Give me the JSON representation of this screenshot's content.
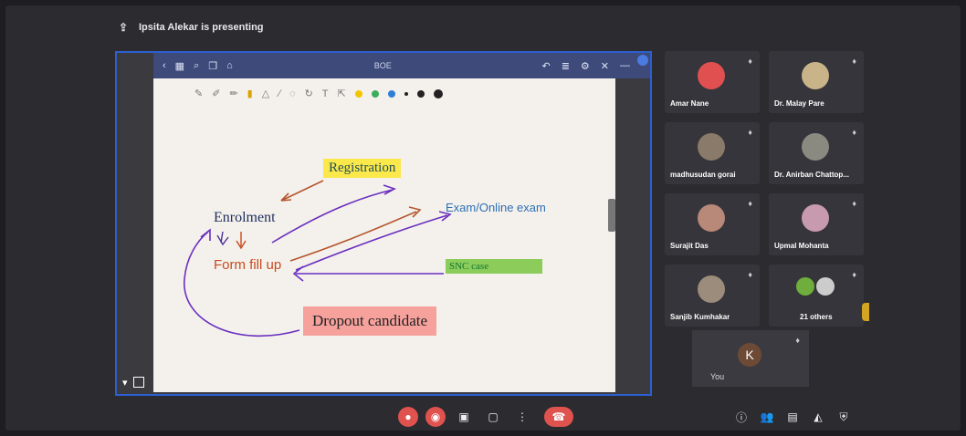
{
  "top_bar": {
    "presenting_text": "Ipsita Alekar is presenting"
  },
  "share": {
    "app_title": "BOE",
    "whiteboard": {
      "registration": "Registration",
      "enrolment": "Enrolment",
      "exam": "Exam/Online exam",
      "form": "Form fill up",
      "snc": "SNC case",
      "dropout": "Dropout candidate"
    }
  },
  "participants": [
    {
      "name": "Amar Nane",
      "avatar_color": "#e05050"
    },
    {
      "name": "Dr. Malay Pare",
      "avatar_color": "#c9b48a"
    },
    {
      "name": "madhusudan gorai",
      "avatar_color": "#8a7a6a"
    },
    {
      "name": "Dr. Anirban Chattop...",
      "avatar_color": "#8a8a80"
    },
    {
      "name": "Surajit Das",
      "avatar_color": "#b88878"
    },
    {
      "name": "Upmal Mohanta",
      "avatar_color": "#c89ab0"
    },
    {
      "name": "Sanjib Kumhakar",
      "avatar_color": "#9c8c7c"
    },
    {
      "name": "21 others",
      "avatar_color": "#6fae3c"
    }
  ],
  "self_view": {
    "initial": "K",
    "text": "You"
  },
  "controls": {
    "more": "⋮"
  }
}
